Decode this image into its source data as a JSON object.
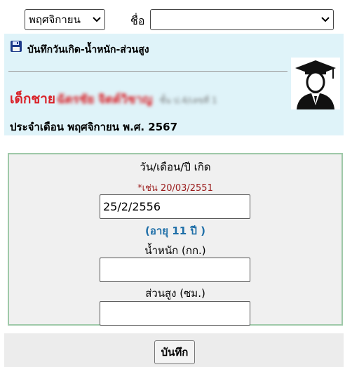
{
  "filters": {
    "month_value": "พฤศจิกายน",
    "name_label": "ชื่อ",
    "name_value": ""
  },
  "header": {
    "title": "บันทึกวันเกิด-น้ำหนัก-ส่วนสูง",
    "student_prefix": "เด็กชาย",
    "student_name": "ฉัตรชัย จิตต์วิชาญ",
    "student_class": "ชั้น ป.4/เลขที่ 1",
    "month_line": "ประจำเดือน พฤศจิกายน พ.ศ. 2567"
  },
  "form": {
    "birthdate_label": "วัน/เดือน/ปี เกิด",
    "birthdate_hint": "*เช่น 20/03/2551",
    "birthdate_value": "25/2/2556",
    "age_text": "(อายุ 11 ปี )",
    "weight_label": "น้ำหนัก (กก.)",
    "weight_value": "",
    "height_label": "ส่วนสูง (ซม.)",
    "height_value": "",
    "save_label": "บันทึก"
  },
  "icons": {
    "save": "floppy-disk-icon",
    "avatar": "graduate-avatar-icon",
    "dropdown": "chevron-down-icon"
  },
  "colors": {
    "info_background": "#dff3f9",
    "student_prefix": "#d9232a",
    "hint": "#9a1b1b",
    "age": "#1f6fa8",
    "form_border": "#9fc9a9"
  }
}
